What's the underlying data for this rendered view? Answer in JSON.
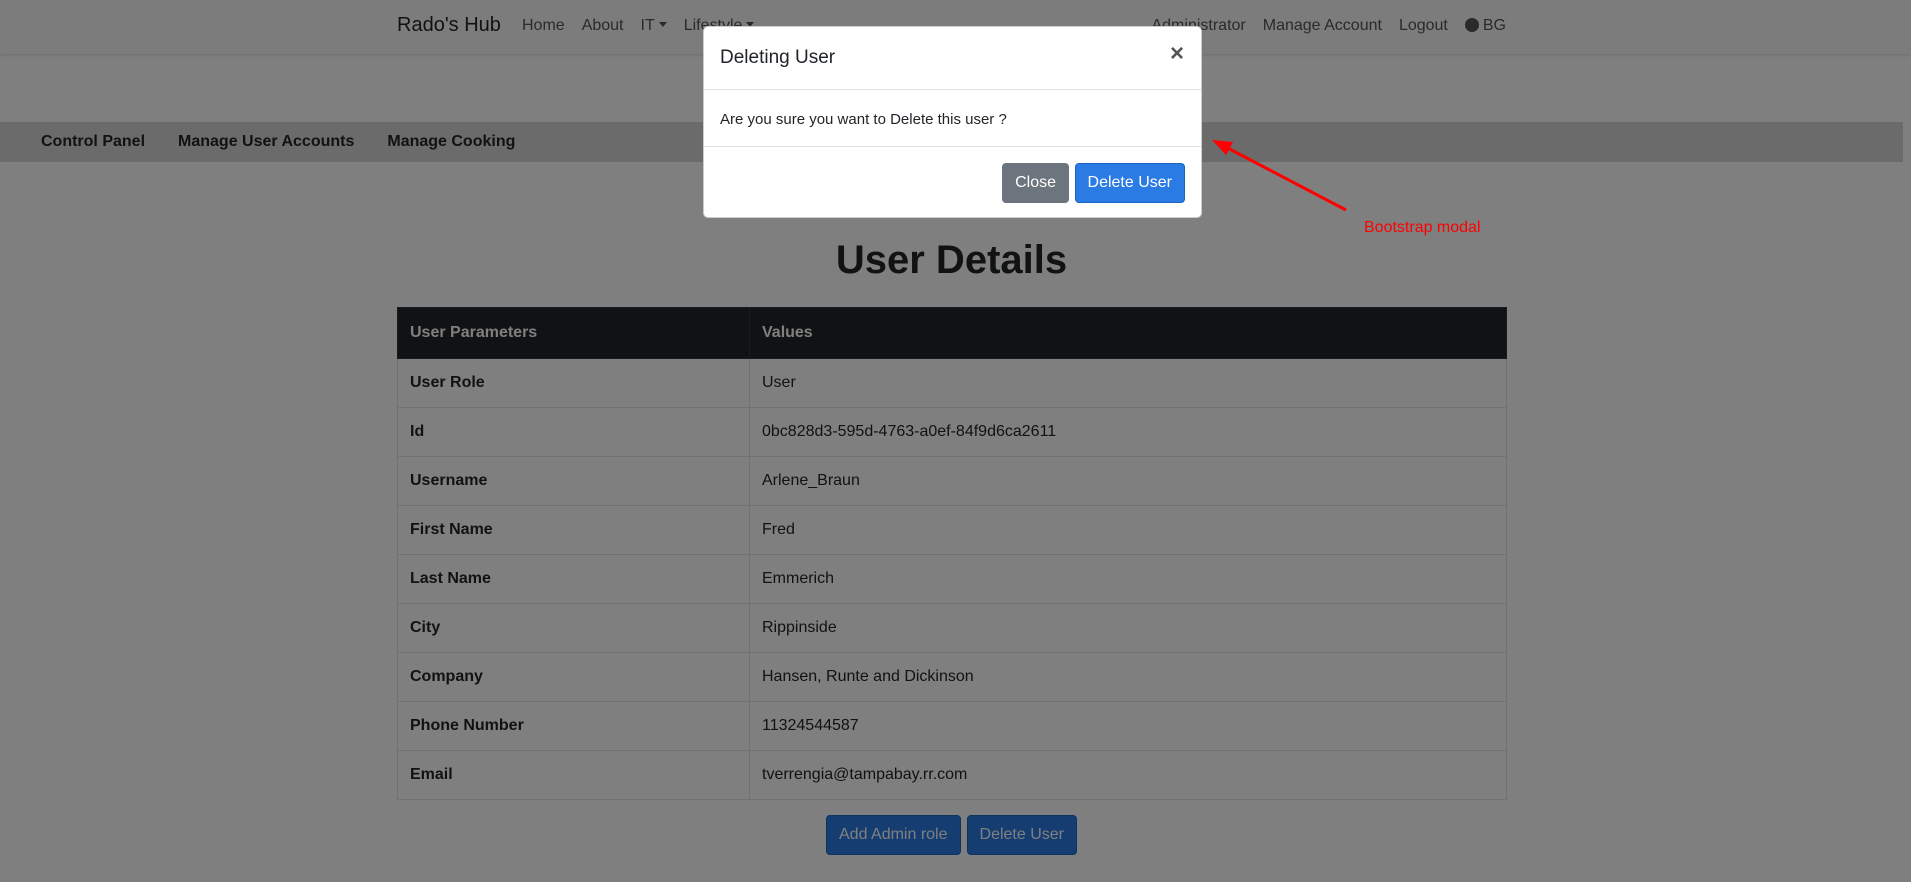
{
  "navbar": {
    "brand": "Rado's Hub",
    "left_items": [
      "Home",
      "About",
      "IT",
      "Lifestyle"
    ],
    "right_items": [
      "Administrator",
      "Manage Account",
      "Logout"
    ],
    "language": "BG",
    "language_icon": "globe-icon"
  },
  "admin_nav": {
    "items": [
      "Control Panel",
      "Manage User Accounts",
      "Manage Cooking"
    ]
  },
  "page": {
    "title": "User Details"
  },
  "table": {
    "headers": [
      "User Parameters",
      "Values"
    ],
    "rows": [
      {
        "param": "User Role",
        "value": "User"
      },
      {
        "param": "Id",
        "value": "0bc828d3-595d-4763-a0ef-84f9d6ca2611"
      },
      {
        "param": "Username",
        "value": "Arlene_Braun"
      },
      {
        "param": "First Name",
        "value": "Fred"
      },
      {
        "param": "Last Name",
        "value": "Emmerich"
      },
      {
        "param": "City",
        "value": "Rippinside"
      },
      {
        "param": "Company",
        "value": "Hansen, Runte and Dickinson"
      },
      {
        "param": "Phone Number",
        "value": "11324544587"
      },
      {
        "param": "Email",
        "value": "tverrengia@tampabay.rr.com"
      }
    ]
  },
  "actions": {
    "add_admin_label": "Add Admin role",
    "delete_user_label": "Delete User"
  },
  "modal": {
    "title": "Deleting User",
    "close_glyph": "×",
    "body": "Are you sure you want to Delete this user ?",
    "close_label": "Close",
    "confirm_label": "Delete User"
  },
  "annotation": {
    "label": "Bootstrap modal",
    "color": "#ff0000"
  },
  "colors": {
    "primary": "#2a7be4",
    "secondary": "#6c757d",
    "table_header": "#212529"
  }
}
